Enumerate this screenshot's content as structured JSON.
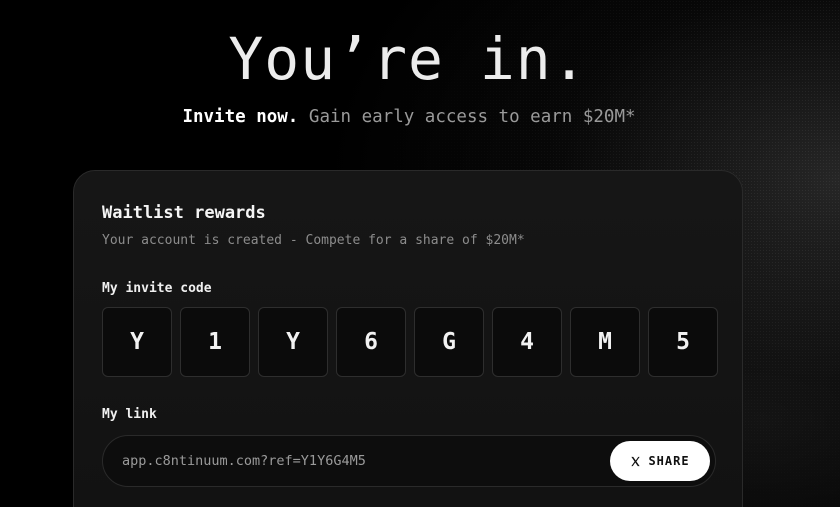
{
  "hero": {
    "title": "You’re in.",
    "subtitle_strong": "Invite now.",
    "subtitle_rest": "Gain early access to earn $20M*"
  },
  "card": {
    "title": "Waitlist rewards",
    "subtitle": "Your account is created - Compete for a share of $20M*",
    "invite_code_label": "My invite code",
    "invite_code": [
      "Y",
      "1",
      "Y",
      "6",
      "G",
      "4",
      "M",
      "5"
    ],
    "link_label": "My link",
    "link_value": "app.c8ntinuum.com?ref=Y1Y6G4M5",
    "share_label": "SHARE",
    "share_icon": "x-logo-icon"
  }
}
